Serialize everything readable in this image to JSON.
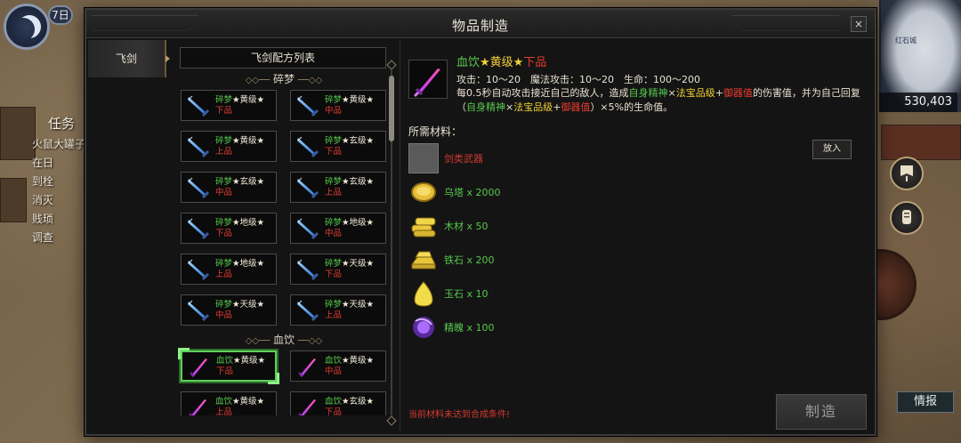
{
  "hud": {
    "day": "7日",
    "quest_title": "任务",
    "quest_lines": [
      "火鼠大罐子",
      "在日",
      "到栓",
      "消灭",
      "贱琐",
      "调查"
    ],
    "minimap_label": "红石城",
    "gold": "530,403",
    "intel_label": "情报"
  },
  "modal": {
    "title": "物品制造",
    "close_label": "×",
    "category_tab": "飞剑",
    "list_header": "飞剑配方列表",
    "craft_label": "制造",
    "warning": "当前材料未达到合成条件!"
  },
  "recipe_groups": [
    {
      "name": "碎梦",
      "items": [
        {
          "name": "碎梦",
          "grade": "★黄级★",
          "quality": "下品"
        },
        {
          "name": "碎梦",
          "grade": "★黄级★",
          "quality": "中品"
        },
        {
          "name": "碎梦",
          "grade": "★黄级★",
          "quality": "上品"
        },
        {
          "name": "碎梦",
          "grade": "★玄级★",
          "quality": "下品"
        },
        {
          "name": "碎梦",
          "grade": "★玄级★",
          "quality": "中品"
        },
        {
          "name": "碎梦",
          "grade": "★玄级★",
          "quality": "上品"
        },
        {
          "name": "碎梦",
          "grade": "★地级★",
          "quality": "下品"
        },
        {
          "name": "碎梦",
          "grade": "★地级★",
          "quality": "中品"
        },
        {
          "name": "碎梦",
          "grade": "★地级★",
          "quality": "上品"
        },
        {
          "name": "碎梦",
          "grade": "★天级★",
          "quality": "下品"
        },
        {
          "name": "碎梦",
          "grade": "★天级★",
          "quality": "中品"
        },
        {
          "name": "碎梦",
          "grade": "★天级★",
          "quality": "上品"
        }
      ]
    },
    {
      "name": "血饮",
      "items": [
        {
          "name": "血饮",
          "grade": "★黄级★",
          "quality": "下品",
          "selected": true
        },
        {
          "name": "血饮",
          "grade": "★黄级★",
          "quality": "中品"
        },
        {
          "name": "血饮",
          "grade": "★黄级★",
          "quality": "上品"
        },
        {
          "name": "血饮",
          "grade": "★玄级★",
          "quality": "下品"
        }
      ]
    }
  ],
  "detail": {
    "name": "血饮",
    "grade": "★黄级★",
    "quality": "下品",
    "stats": "攻击：10～20　魔法攻击：10～20　生命：100～200",
    "desc_1": "每0.5秒自动攻击接近自己的敌人，造成",
    "desc_hl_1": "自身精神",
    "desc_2": "×",
    "desc_hl_2": "法宝品级",
    "desc_3": "+",
    "desc_hl_3": "御器值",
    "desc_4": "的伤害值，并为自己回复",
    "desc_5": "（",
    "desc_hl_4": "自身精神",
    "desc_6": "×",
    "desc_hl_5": "法宝品级",
    "desc_7": "+",
    "desc_hl_6": "御器值",
    "desc_8": "）×5%的生命值。",
    "materials_label": "所需材料：",
    "place_label": "放入",
    "materials": [
      {
        "name": "剑类武器",
        "icon": "empty-slot",
        "missing": true
      },
      {
        "name": "乌塔 x 2000",
        "icon": "coin-icon"
      },
      {
        "name": "木材 x 50",
        "icon": "wood-icon"
      },
      {
        "name": "铁石 x 200",
        "icon": "iron-ore-icon"
      },
      {
        "name": "玉石 x 10",
        "icon": "jade-icon"
      },
      {
        "name": "精魄 x 100",
        "icon": "soul-orb-icon"
      }
    ]
  },
  "colors": {
    "green": "#57c84d",
    "yellow": "#f0d038",
    "red": "#ea3b30",
    "selection": "#5fcf5a"
  }
}
